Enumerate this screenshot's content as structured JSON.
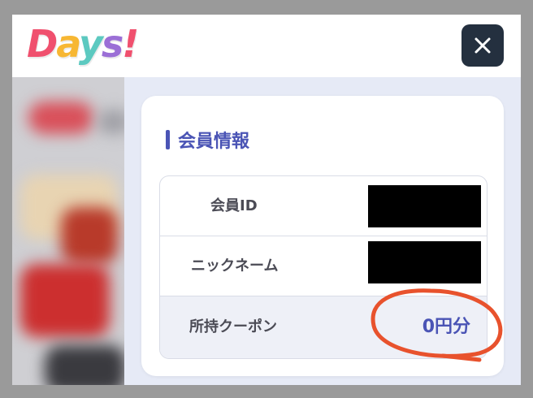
{
  "header": {
    "logo": [
      "D",
      "a",
      "y",
      "s",
      "!"
    ],
    "logo_colors": [
      "#f0506e",
      "#f7b733",
      "#5cc9c0",
      "#9b6fd6",
      "#f0506e"
    ],
    "close_icon": "close-icon"
  },
  "member_info": {
    "title": "会員情報",
    "rows": [
      {
        "label": "会員ID",
        "value": ""
      },
      {
        "label": "ニックネーム",
        "value": ""
      },
      {
        "label": "所持クーポン",
        "value": "0円分"
      }
    ]
  },
  "colors": {
    "accent": "#4a54b5",
    "close_button": "#24303f",
    "annotation_circle": "#e8522d"
  }
}
